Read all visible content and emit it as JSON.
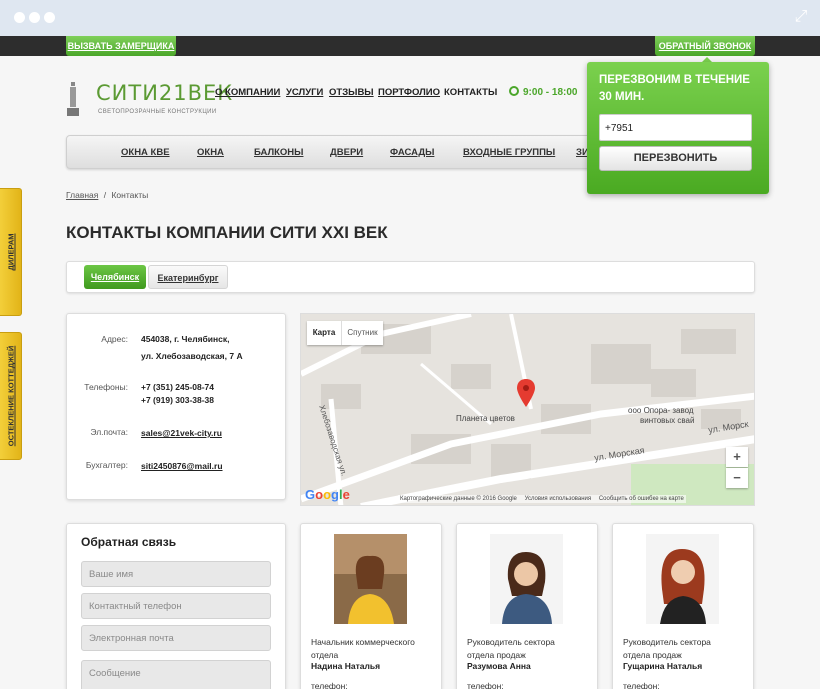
{
  "header": {
    "call_measurer": "ВЫЗВАТЬ ЗАМЕРЩИКА",
    "callback": "ОБРАТНЫЙ ЗВОНОК",
    "logo_text": "СИТИ21ВЕК",
    "logo_sub": "СВЕТОПРОЗРАЧНЫЕ КОНСТРУКЦИИ",
    "nav": [
      "О КОМПАНИИ",
      "УСЛУГИ",
      "ОТЗЫВЫ",
      "ПОРТФОЛИО",
      "КОНТАКТЫ"
    ],
    "hours": "9:00 - 18:00",
    "menu": [
      "ОКНА КВЕ",
      "ОКНА",
      "БАЛКОНЫ",
      "ДВЕРИ",
      "ФАСАДЫ",
      "ВХОДНЫЕ ГРУППЫ",
      "ЗИ"
    ]
  },
  "popup": {
    "title": "ПЕРЕЗВОНИМ В ТЕЧЕНИЕ 30 МИН.",
    "phone_value": "+7951",
    "button": "ПЕРЕЗВОНИТЬ"
  },
  "side_tabs": [
    "ДИЛЕРАМ",
    "ОСТЕКЛЕНИЕ КОТТЕДЖЕЙ"
  ],
  "breadcrumb": {
    "home": "Главная",
    "sep": "/",
    "current": "Контакты"
  },
  "page_title": "КОНТАКТЫ КОМПАНИИ СИТИ XXI ВЕК",
  "cities": [
    "Челябинск",
    "Екатеринбург"
  ],
  "contacts": {
    "address_label": "Адрес:",
    "address_line1": "454038, г. Челябинск,",
    "address_line2": "ул. Хлебозаводская, 7 А",
    "phones_label": "Телефоны:",
    "phone1": "+7 (351) 245-08-74",
    "phone2": "+7 (919) 303-38-38",
    "email_label": "Эл.почта:",
    "email": "sales@21vek-city.ru",
    "accountant_label": "Бухгалтер:",
    "accountant_email": "siti2450876@mail.ru"
  },
  "map": {
    "tab_map": "Карта",
    "tab_satellite": "Спутник",
    "poi1": "Планета цветов",
    "poi2": "ооо Опора- завод",
    "poi2b": "винтовых свай",
    "street1": "ул. Морская",
    "street2": "ул. Морск",
    "street3": "Хлебозаводская ул.",
    "google": "Google",
    "data_credit": "Картографические данные © 2016 Google",
    "terms": "Условия использования",
    "report": "Сообщить об ошибке на карте",
    "zoom_in": "+",
    "zoom_out": "−"
  },
  "feedback": {
    "title": "Обратная связь",
    "name_ph": "Ваше имя",
    "phone_ph": "Контактный телефон",
    "email_ph": "Электронная почта",
    "message_ph": "Сообщение"
  },
  "people": [
    {
      "role1": "Начальник коммерческого",
      "role2": "отдела",
      "name": "Надина Наталья",
      "phone": "телефон:"
    },
    {
      "role1": "Руководитель сектора",
      "role2": "отдела продаж",
      "name": "Разумова Анна",
      "phone": "телефон:"
    },
    {
      "role1": "Руководитель сектора",
      "role2": "отдела продаж",
      "name": "Гущарина Наталья",
      "phone": "телефон:"
    }
  ],
  "colors": {
    "accent_green": "#4ba62a",
    "side_tab_yellow": "#e9c12a",
    "topbar": "#2d2d2d"
  }
}
